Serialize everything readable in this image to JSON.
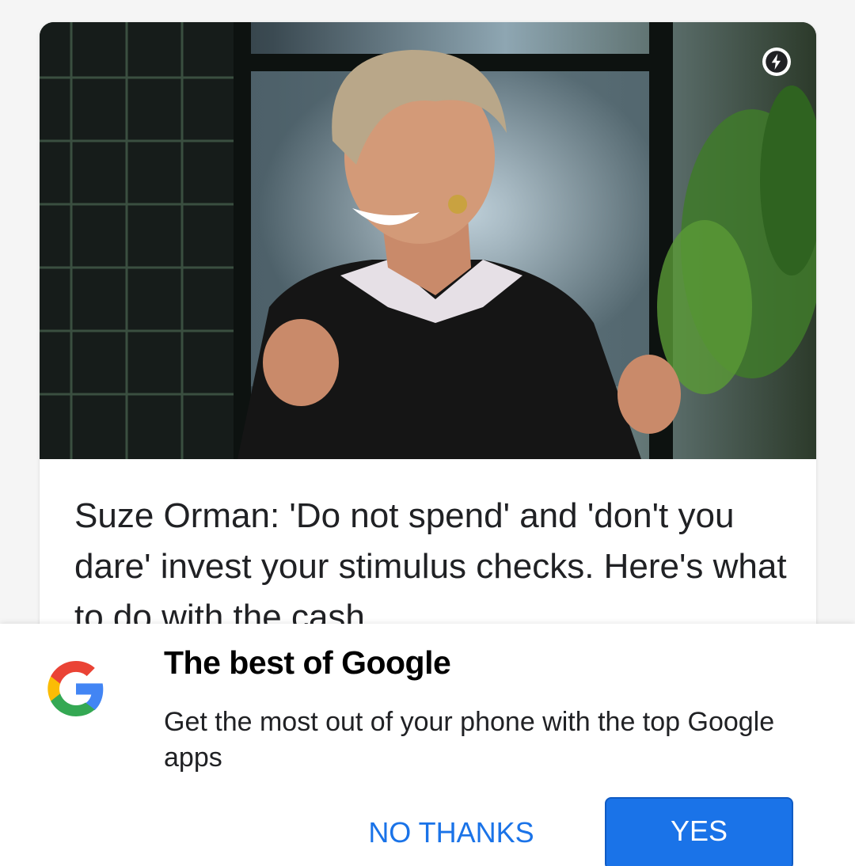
{
  "article": {
    "title": "Suze Orman: 'Do not spend' and 'don't you dare' invest your stimulus checks. Here's what to do with the cash",
    "image_icon": "amp-lightning-icon"
  },
  "prompt": {
    "logo_icon": "google-g-icon",
    "title": "The best of Google",
    "body": "Get the most out of your phone with the top Google apps",
    "no_label": "NO THANKS",
    "yes_label": "YES"
  },
  "colors": {
    "accent": "#1a73e8",
    "google_blue": "#4285f4",
    "google_red": "#ea4335",
    "google_yellow": "#fbbc05",
    "google_green": "#34a853"
  }
}
